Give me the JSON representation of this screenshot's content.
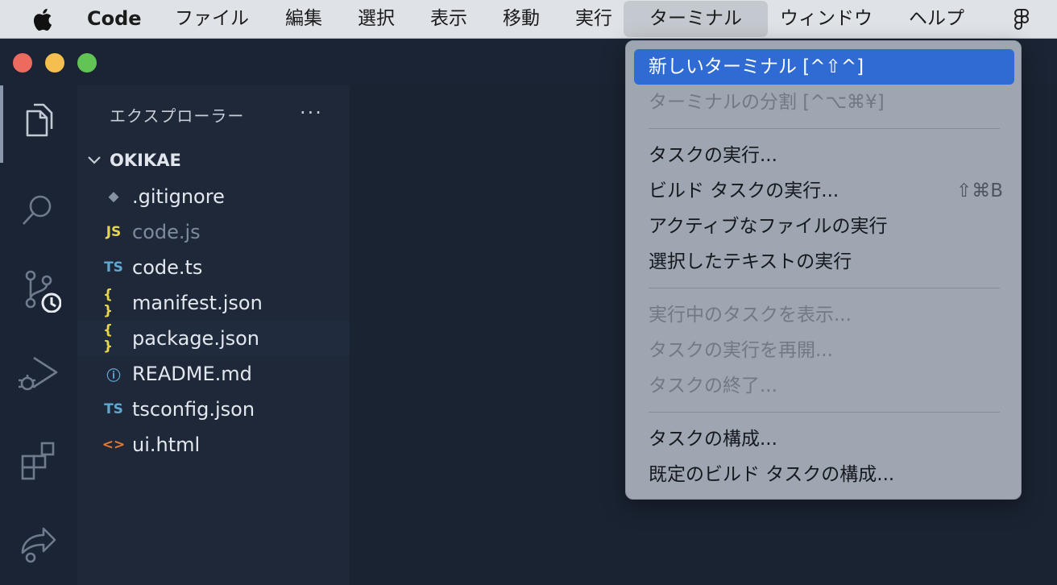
{
  "menubar": {
    "app_name": "Code",
    "menus": [
      "ファイル",
      "編集",
      "選択",
      "表示",
      "移動",
      "実行",
      "ターミナル",
      "ウィンドウ",
      "ヘルプ"
    ],
    "active_menu": "ターミナル"
  },
  "sidebar": {
    "title": "エクスプローラー",
    "more": "···",
    "folder": "OKIKAE",
    "files": [
      {
        "name": ".gitignore",
        "icon": "git-icon",
        "badge": "◆",
        "color": "#8592a3"
      },
      {
        "name": "code.js",
        "icon": "javascript-icon",
        "badge": "JS",
        "color": "#e8d44d",
        "dim": true
      },
      {
        "name": "code.ts",
        "icon": "typescript-icon",
        "badge": "TS",
        "color": "#5fa8d3"
      },
      {
        "name": "manifest.json",
        "icon": "json-icon",
        "badge": "{ }",
        "color": "#e8d44d"
      },
      {
        "name": "package.json",
        "icon": "json-icon",
        "badge": "{ }",
        "color": "#e8d44d",
        "selected": true
      },
      {
        "name": "README.md",
        "icon": "info-icon",
        "badge": "ⓘ",
        "color": "#5fa8d3"
      },
      {
        "name": "tsconfig.json",
        "icon": "tsconfig-icon",
        "badge": "TS",
        "color": "#5fa8d3"
      },
      {
        "name": "ui.html",
        "icon": "html-icon",
        "badge": "<>",
        "color": "#e37933"
      }
    ]
  },
  "terminal_menu": {
    "items": [
      {
        "label": "新しいターミナル [^⇧^]",
        "shortcut": "",
        "state": "highlight"
      },
      {
        "label": "ターミナルの分割 [^⌥⌘¥]",
        "shortcut": "",
        "state": "disabled"
      },
      {
        "label": "タスクの実行...",
        "shortcut": "",
        "state": "normal"
      },
      {
        "label": "ビルド タスクの実行...",
        "shortcut": "⇧⌘B",
        "state": "normal"
      },
      {
        "label": "アクティブなファイルの実行",
        "shortcut": "",
        "state": "normal"
      },
      {
        "label": "選択したテキストの実行",
        "shortcut": "",
        "state": "normal"
      },
      {
        "label": "実行中のタスクを表示...",
        "shortcut": "",
        "state": "disabled"
      },
      {
        "label": "タスクの実行を再開...",
        "shortcut": "",
        "state": "disabled"
      },
      {
        "label": "タスクの終了...",
        "shortcut": "",
        "state": "disabled"
      },
      {
        "label": "タスクの構成...",
        "shortcut": "",
        "state": "normal"
      },
      {
        "label": "既定のビルド タスクの構成...",
        "shortcut": "",
        "state": "normal"
      }
    ]
  },
  "colors": {
    "highlight": "#2f6bd2",
    "menu_bg": "#9ea6b1",
    "sidebar_bg": "#1e2838"
  }
}
